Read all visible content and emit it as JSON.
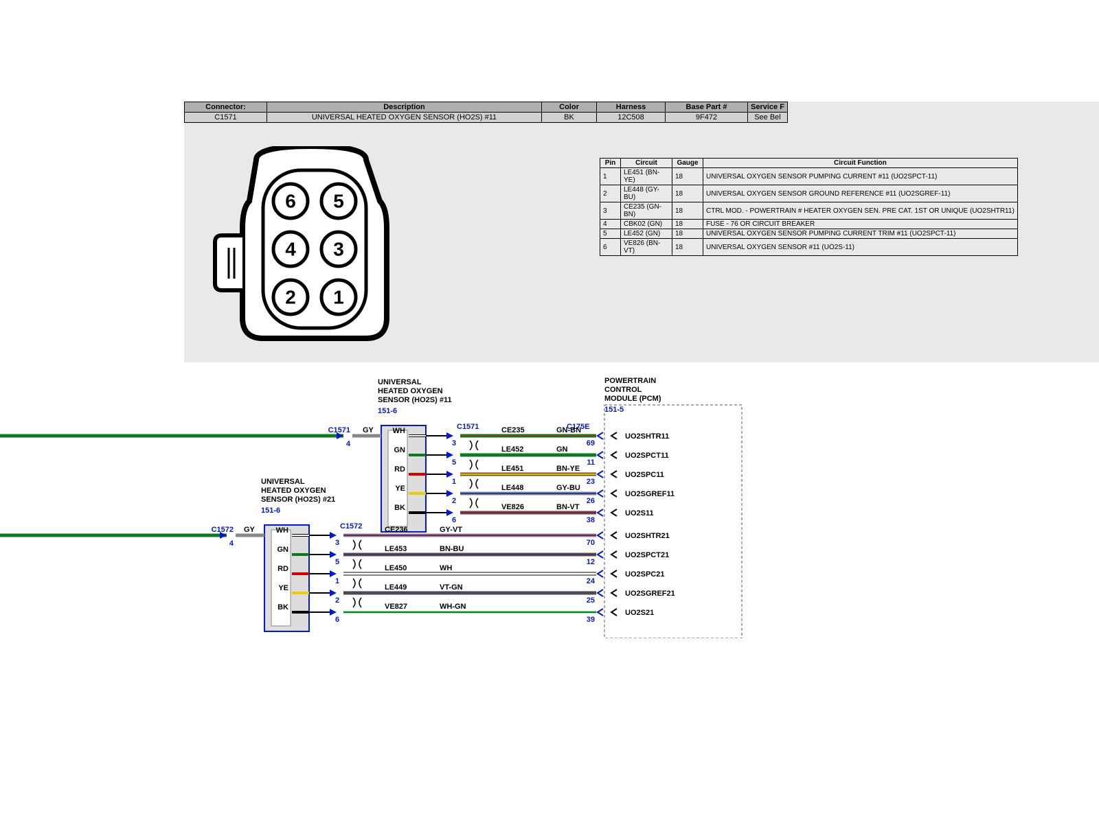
{
  "header": {
    "cols": [
      "Connector:",
      "Description",
      "Color",
      "Harness",
      "Base Part #",
      "Service F"
    ],
    "vals": [
      "C1571",
      "UNIVERSAL HEATED OXYGEN SENSOR (HO2S) #11",
      "BK",
      "12C508",
      "9F472",
      "See Bel"
    ]
  },
  "pin_table": {
    "cols": [
      "Pin",
      "Circuit",
      "Gauge",
      "Circuit Function"
    ],
    "rows": [
      [
        "1",
        "LE451 (BN-YE)",
        "18",
        "UNIVERSAL OXYGEN SENSOR PUMPING CURRENT #11 (UO2SPCT-11)"
      ],
      [
        "2",
        "LE448 (GY-BU)",
        "18",
        "UNIVERSAL OXYGEN SENSOR GROUND REFERENCE #11 (UO2SGREF-11)"
      ],
      [
        "3",
        "CE235 (GN-BN)",
        "18",
        "CTRL MOD. - POWERTRAIN # HEATER OXYGEN SEN. PRE CAT. 1ST OR UNIQUE (UO2SHTR11)"
      ],
      [
        "4",
        "CBK02 (GN)",
        "18",
        "FUSE - 76 OR CIRCUIT BREAKER"
      ],
      [
        "5",
        "LE452 (GN)",
        "18",
        "UNIVERSAL OXYGEN SENSOR PUMPING CURRENT TRIM #11 (UO2SPCT-11)"
      ],
      [
        "6",
        "VE826 (BN-VT)",
        "18",
        "UNIVERSAL OXYGEN SENSOR #11 (UO2S-11)"
      ]
    ]
  },
  "connector_pins": [
    "6",
    "5",
    "4",
    "3",
    "2",
    "1"
  ],
  "wiring": {
    "sensor11": {
      "title": "UNIVERSAL\nHEATED OXYGEN\nSENSOR (HO2S) #11",
      "ref": "151-6"
    },
    "sensor21": {
      "title": "UNIVERSAL\nHEATED OXYGEN\nSENSOR (HO2S) #21",
      "ref": "151-6"
    },
    "pcm": {
      "title": "POWERTRAIN\nCONTROL\nMODULE (PCM)",
      "ref": "151-5"
    },
    "conn": {
      "c1571": "C1571",
      "c1572": "C1572",
      "c175e": "C175E"
    },
    "signals": {
      "uo2shtr11": "UO2SHTR11",
      "uo2spct11": "UO2SPCT11",
      "uo2spc11": "UO2SPC11",
      "uo2sgref11": "UO2SGREF11",
      "uo2s11": "UO2S11",
      "uo2shtr21": "UO2SHTR21",
      "uo2spct21": "UO2SPCT21",
      "uo2spc21": "UO2SPC21",
      "uo2sgref21": "UO2SGREF21",
      "uo2s21": "UO2S21"
    },
    "wires_top": [
      {
        "pin_color": "WH",
        "circuit": "CE235",
        "wire_color": "GN-BN",
        "pcm_pin": "69",
        "sensor_pin": "3"
      },
      {
        "pin_color": "GN",
        "circuit": "LE452",
        "wire_color": "GN",
        "pcm_pin": "11",
        "sensor_pin": "5"
      },
      {
        "pin_color": "RD",
        "circuit": "LE451",
        "wire_color": "BN-YE",
        "pcm_pin": "23",
        "sensor_pin": "1"
      },
      {
        "pin_color": "YE",
        "circuit": "LE448",
        "wire_color": "GY-BU",
        "pcm_pin": "26",
        "sensor_pin": "2"
      },
      {
        "pin_color": "BK",
        "circuit": "VE826",
        "wire_color": "BN-VT",
        "pcm_pin": "38",
        "sensor_pin": "6"
      }
    ],
    "wires_bot": [
      {
        "pin_color": "WH",
        "circuit": "CE236",
        "wire_color": "GY-VT",
        "pcm_pin": "70",
        "sensor_pin": "3"
      },
      {
        "pin_color": "GN",
        "circuit": "LE453",
        "wire_color": "BN-BU",
        "pcm_pin": "12",
        "sensor_pin": "5"
      },
      {
        "pin_color": "RD",
        "circuit": "LE450",
        "wire_color": "WH",
        "pcm_pin": "24",
        "sensor_pin": "1"
      },
      {
        "pin_color": "YE",
        "circuit": "LE449",
        "wire_color": "VT-GN",
        "pcm_pin": "25",
        "sensor_pin": "2"
      },
      {
        "pin_color": "BK",
        "circuit": "VE827",
        "wire_color": "WH-GN",
        "pcm_pin": "39",
        "sensor_pin": "6"
      }
    ],
    "gy": "GY",
    "pin4": "4"
  }
}
